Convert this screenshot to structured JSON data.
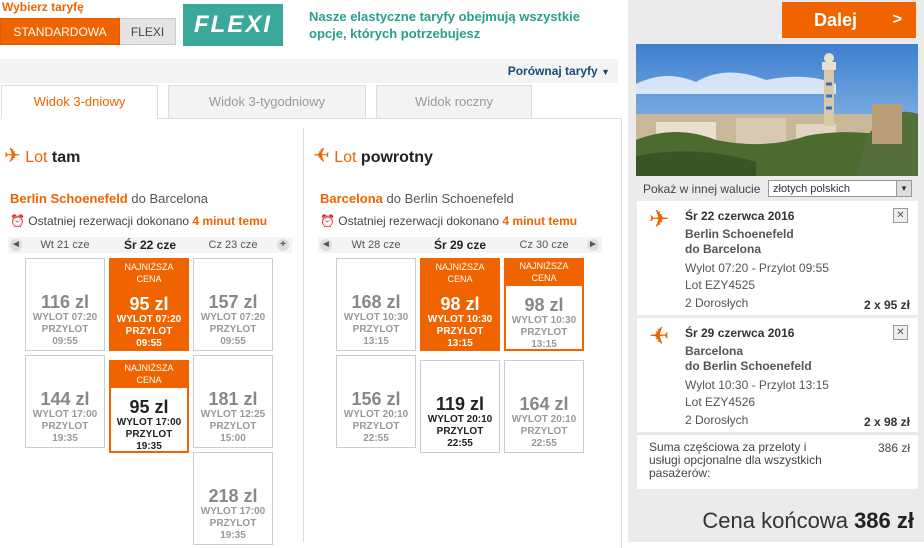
{
  "fare": {
    "title": "Wybierz taryfę",
    "standard_label": "STANDARDOWA",
    "flexi_label": "FLEXI",
    "logo_text": "FLEXI",
    "description": "Nasze elastyczne taryfy obejmują wszystkie opcje, których potrzebujesz",
    "compare_label": "Porównaj taryfy"
  },
  "tabs": [
    "Widok 3-dniowy",
    "Widok 3-tygodniowy",
    "Widok roczny"
  ],
  "outbound": {
    "title_light": "Lot",
    "title_bold": "tam",
    "origin": "Berlin Schoenefeld",
    "dest_prefix": "do",
    "dest": "Barcelona",
    "lastres_prefix": "Ostatniej rezerwacji dokonano",
    "lastres_time": "4 minut temu",
    "days": [
      "Wt 21 cze",
      "Śr 22 cze",
      "Cz 23 cze"
    ],
    "cards": [
      {
        "price": "116 zl",
        "line1": "WYLOT 07:20",
        "line2": "PRZYLOT",
        "line3": "09:55"
      },
      {
        "price": "144 zl",
        "line1": "WYLOT 17:00",
        "line2": "PRZYLOT",
        "line3": "19:35"
      },
      {
        "badge1": "NAJNIŻSZA",
        "badge2": "CENA",
        "price": "95 zl",
        "line1": "WYLOT 07:20",
        "line2": "PRZYLOT",
        "line3": "09:55"
      },
      {
        "badge1": "NAJNIŻSZA",
        "badge2": "CENA",
        "price": "95 zl",
        "line1": "WYLOT 17:00",
        "line2": "PRZYLOT",
        "line3": "19:35"
      },
      {
        "price": "157 zl",
        "line1": "WYLOT 07:20",
        "line2": "PRZYLOT",
        "line3": "09:55"
      },
      {
        "price": "181 zl",
        "line1": "WYLOT 12:25",
        "line2": "PRZYLOT",
        "line3": "15:00"
      },
      {
        "price": "218 zl",
        "line1": "WYLOT 17:00",
        "line2": "PRZYLOT",
        "line3": "19:35"
      }
    ]
  },
  "inbound": {
    "title_light": "Lot",
    "title_bold": "powrotny",
    "origin": "Barcelona",
    "dest_prefix": "do",
    "dest": "Berlin Schoenefeld",
    "lastres_prefix": "Ostatniej rezerwacji dokonano",
    "lastres_time": "4 minut temu",
    "days": [
      "Wt 28 cze",
      "Śr 29 cze",
      "Cz 30 cze"
    ],
    "cards": [
      {
        "price": "168 zl",
        "line1": "WYLOT 10:30",
        "line2": "PRZYLOT",
        "line3": "13:15"
      },
      {
        "price": "156 zl",
        "line1": "WYLOT 20:10",
        "line2": "PRZYLOT",
        "line3": "22:55"
      },
      {
        "badge1": "NAJNIŻSZA",
        "badge2": "CENA",
        "price": "98 zl",
        "line1": "WYLOT 10:30",
        "line2": "PRZYLOT",
        "line3": "13:15"
      },
      {
        "price": "119 zl",
        "line1": "WYLOT 20:10",
        "line2": "PRZYLOT",
        "line3": "22:55"
      },
      {
        "badge1": "NAJNIŻSZA",
        "badge2": "CENA",
        "price": "98 zl",
        "line1": "WYLOT 10:30",
        "line2": "PRZYLOT",
        "line3": "13:15"
      },
      {
        "price": "164 zl",
        "line1": "WYLOT 20:10",
        "line2": "PRZYLOT",
        "line3": "22:55"
      }
    ]
  },
  "sidebar": {
    "next_label": "Dalej",
    "next_arrow": ">",
    "currency_label": "Pokaż w innej walucie",
    "currency_value": "złotych polskich",
    "flight1": {
      "date": "Śr 22 czerwca 2016",
      "route1": "Berlin Schoenefeld",
      "route2": "do Barcelona",
      "times": "Wylot 07:20 - Przylot 09:55",
      "flight_no": "Lot EZY4525",
      "pax": "2 Dorosłych",
      "price": "2 x 95 zł"
    },
    "flight2": {
      "date": "Śr 29 czerwca 2016",
      "route1": "Barcelona",
      "route2": "do Berlin Schoenefeld",
      "times": "Wylot 10:30 - Przylot 13:15",
      "flight_no": "Lot EZY4526",
      "pax": "2 Dorosłych",
      "price": "2 x 98 zł"
    },
    "subtotal_label": "Suma częściowa za przeloty i usługi opcjonalne dla wszystkich pasażerów:",
    "subtotal_value": "386 zł",
    "final_label": "Cena końcowa",
    "final_value": "386 zł"
  },
  "colors": {
    "accent": "#f06400",
    "teal": "#3aa99a"
  }
}
